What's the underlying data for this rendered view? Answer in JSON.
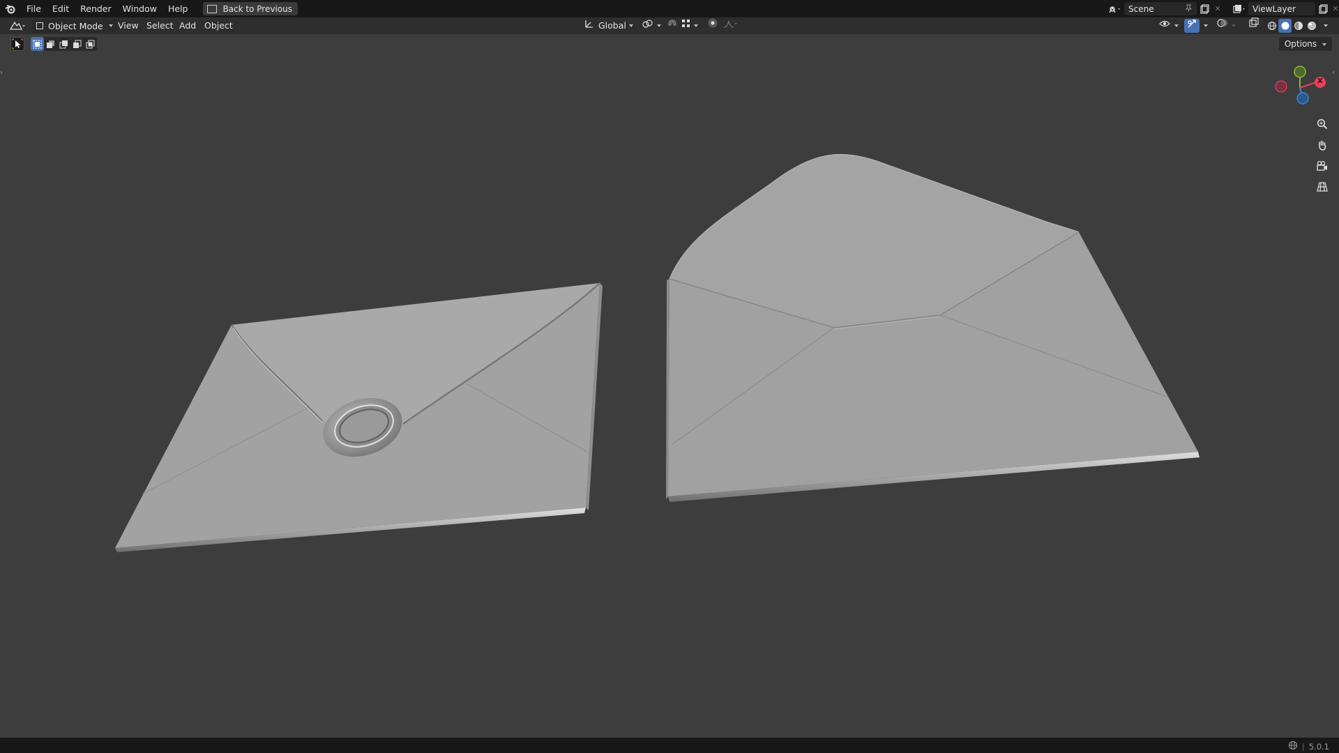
{
  "menu": {
    "file": "File",
    "edit": "Edit",
    "render": "Render",
    "window": "Window",
    "help": "Help"
  },
  "back_button": "Back to Previous",
  "scene": {
    "name": "Scene"
  },
  "view_layer": {
    "name": "ViewLayer"
  },
  "viewport_header": {
    "mode": "Object Mode",
    "view": "View",
    "select": "Select",
    "add": "Add",
    "object": "Object",
    "transform_orientation": "Global"
  },
  "options_label": "Options",
  "gizmo": {
    "x_label": "X"
  },
  "status": {
    "version": "5.0.1"
  },
  "colors": {
    "accent_blue": "#4772b3",
    "axis_x": "#e8405a",
    "axis_y": "#8ab83a",
    "axis_z": "#3e87d8",
    "background": "#3d3d3d"
  }
}
